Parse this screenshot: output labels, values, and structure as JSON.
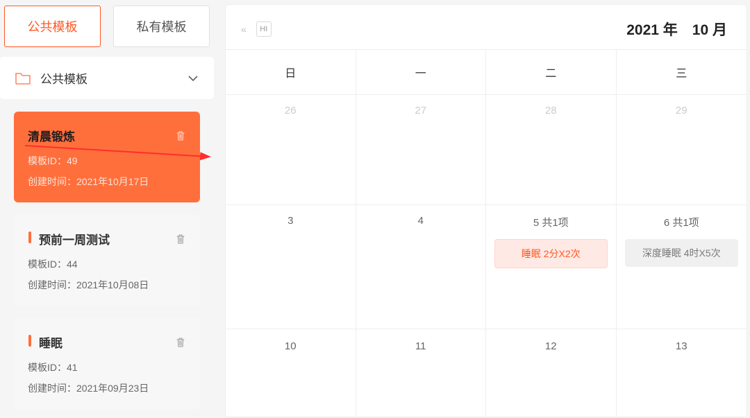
{
  "tabs": {
    "public": "公共模板",
    "private": "私有模板"
  },
  "sidebar": {
    "folder_title": "公共模板",
    "cards": [
      {
        "title": "清晨锻炼",
        "id_row": "模板ID：49",
        "time_row": "创建时间：2021年10月17日"
      },
      {
        "title": "预前一周测试",
        "id_row": "模板ID：44",
        "time_row": "创建时间：2021年10月08日"
      },
      {
        "title": "睡眠",
        "id_row": "模板ID：41",
        "time_row": "创建时间：2021年09月23日"
      }
    ]
  },
  "calendar": {
    "title": "2021 年　10 月",
    "today_abbr": "HI",
    "weekdays": [
      "日",
      "一",
      "二",
      "三"
    ],
    "cells": [
      {
        "label": "26",
        "other": true
      },
      {
        "label": "27",
        "other": true
      },
      {
        "label": "28",
        "other": true
      },
      {
        "label": "29",
        "other": true
      },
      {
        "label": "3"
      },
      {
        "label": "4"
      },
      {
        "label": "5 共1项",
        "event": "睡眠 2分X2次",
        "evt_kind": "primary"
      },
      {
        "label": "6 共1项",
        "event": "深度睡眠 4时X5次",
        "evt_kind": "gray"
      },
      {
        "label": "10"
      },
      {
        "label": "11"
      },
      {
        "label": "12"
      },
      {
        "label": "13"
      }
    ]
  }
}
